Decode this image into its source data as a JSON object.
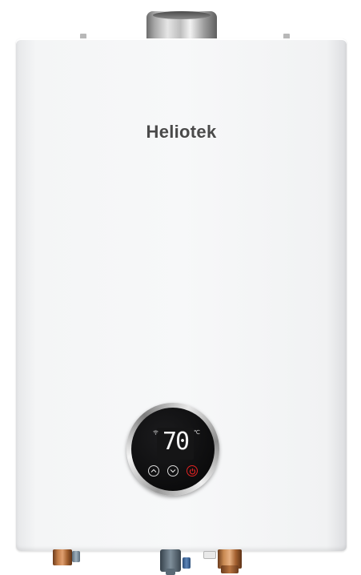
{
  "product": {
    "brand": "Heliotek"
  },
  "display": {
    "temperature": "70",
    "unit": "℃"
  },
  "controls": {
    "buttons": [
      "up-arrow-icon",
      "down-arrow-icon",
      "power-icon"
    ]
  },
  "colors": {
    "cabinet": "#f4f5f6",
    "dial_face": "#0c0c0d",
    "power_accent": "#e02222",
    "display_text": "#f4f4f4"
  }
}
